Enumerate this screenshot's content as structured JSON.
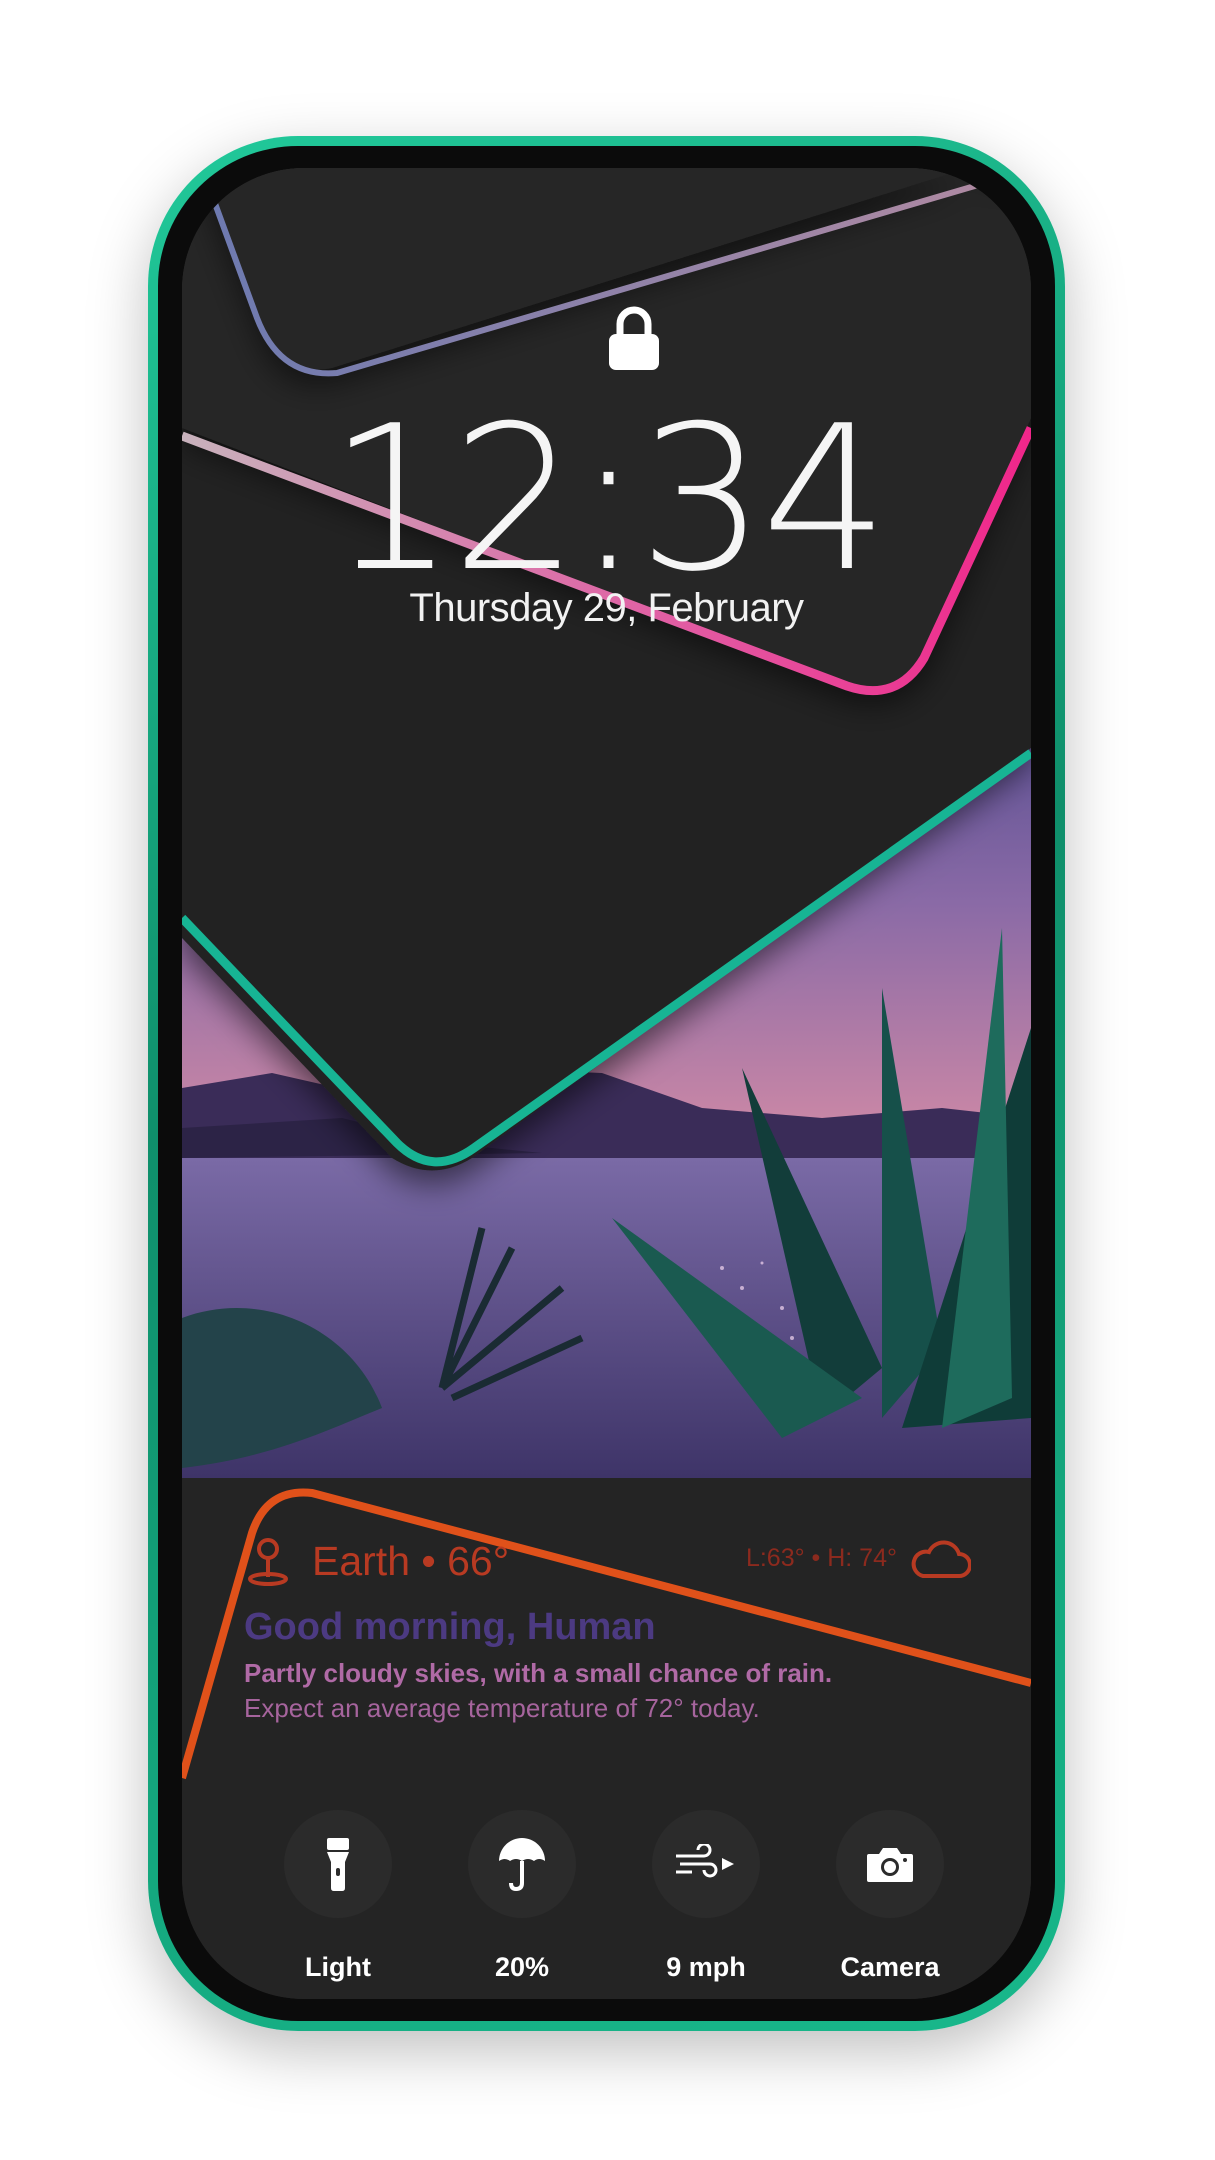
{
  "lock_screen": {
    "time": "12:34",
    "date": "Thursday 29, February"
  },
  "weather": {
    "location": "Earth • 66°",
    "low_high": "L:63° • H: 74°",
    "greeting": "Good morning, Human",
    "summary": "Partly cloudy skies, with a small chance of rain.",
    "detail": "Expect an average temperature of 72° today."
  },
  "quick_actions": [
    {
      "label": "Light",
      "icon": "flashlight-icon"
    },
    {
      "label": "20%",
      "icon": "umbrella-icon"
    },
    {
      "label": "9 mph",
      "icon": "wind-icon"
    },
    {
      "label": "Camera",
      "icon": "camera-icon"
    }
  ],
  "colors": {
    "frame": "#1bb589",
    "screen": "#242424",
    "pink_accent": "#f0268a",
    "teal_accent": "#17b494",
    "orange_accent": "#e0511a"
  }
}
